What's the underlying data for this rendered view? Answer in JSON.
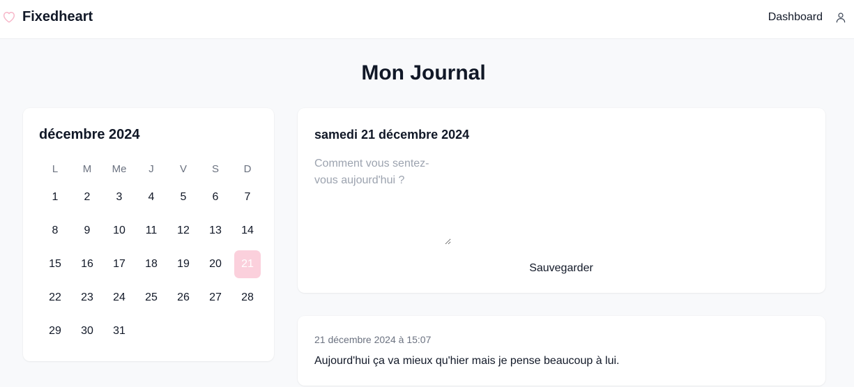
{
  "colors": {
    "accent": "#fbd0dc",
    "accent_outline": "#f7b6c8",
    "page_background": "#f8f9fb",
    "card_background": "#ffffff",
    "text_primary": "#111827",
    "text_muted": "#6b7280"
  },
  "header": {
    "logo_icon": "heart-outline-icon",
    "brand": "Fixedheart",
    "nav_link": "Dashboard",
    "user_icon": "user-icon"
  },
  "page": {
    "title": "Mon Journal"
  },
  "calendar": {
    "month_label": "décembre 2024",
    "weekdays": [
      "L",
      "M",
      "Me",
      "J",
      "V",
      "S",
      "D"
    ],
    "start_offset": 0,
    "days": [
      "1",
      "2",
      "3",
      "4",
      "5",
      "6",
      "7",
      "8",
      "9",
      "10",
      "11",
      "12",
      "13",
      "14",
      "15",
      "16",
      "17",
      "18",
      "19",
      "20",
      "21",
      "22",
      "23",
      "24",
      "25",
      "26",
      "27",
      "28",
      "29",
      "30",
      "31"
    ],
    "selected_day": "21"
  },
  "editor": {
    "date_label": "samedi 21 décembre 2024",
    "placeholder": "Comment vous sentez-vous aujourd'hui ?",
    "value": "",
    "save_label": "Sauvegarder"
  },
  "entries": [
    {
      "timestamp": "21 décembre 2024 à 15:07",
      "text": "Aujourd'hui ça va mieux qu'hier mais je pense beaucoup à lui."
    }
  ]
}
